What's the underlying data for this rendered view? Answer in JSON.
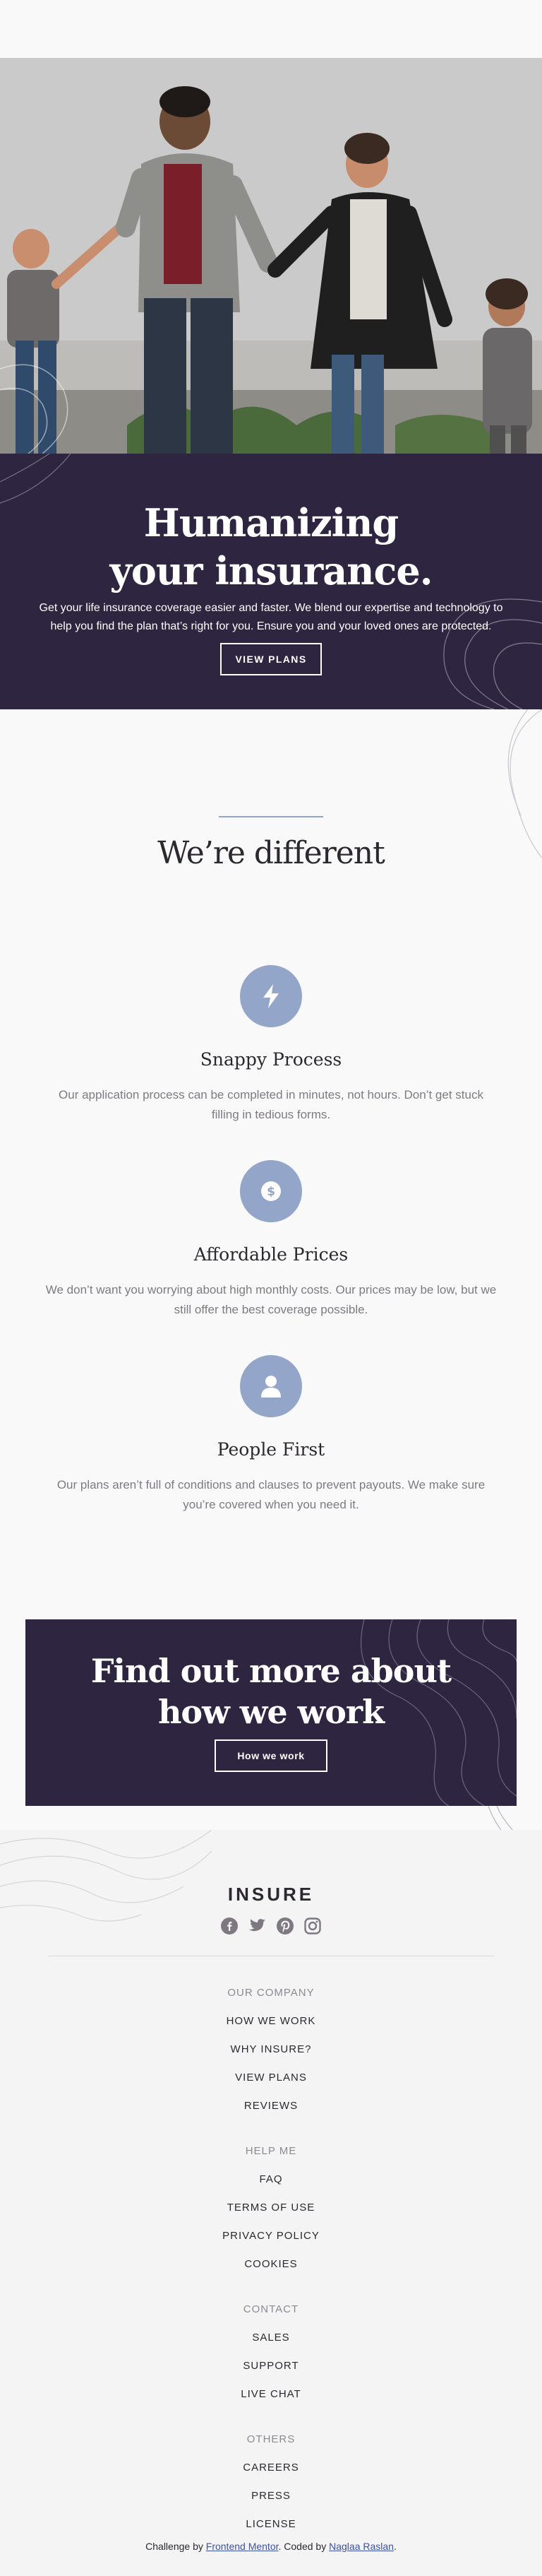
{
  "hero": {
    "title_line1": "Humanizing",
    "title_line2": "your insurance.",
    "text": "Get your life insurance coverage easier and faster. We blend our expertise and technology to help you find the plan that’s right for you. Ensure you and your loved ones are protected.",
    "button_label": "VIEW PLANS"
  },
  "different": {
    "title": "We’re different"
  },
  "features": [
    {
      "icon": "lightning-bolt-icon",
      "title": "Snappy Process",
      "text": "Our application process can be completed in minutes, not hours. Don’t get stuck filling in tedious forms."
    },
    {
      "icon": "dollar-coin-icon",
      "title": "Affordable Prices",
      "text": "We don’t want you worrying about high monthly costs. Our prices may be low, but we still offer the best coverage possible."
    },
    {
      "icon": "person-icon",
      "title": "People First",
      "text": "Our plans aren’t full of conditions and clauses to prevent payouts. We make sure you’re covered when you need it."
    }
  ],
  "cta": {
    "title_line1": "Find out more about",
    "title_line2": "how we work",
    "button_label": "How we work"
  },
  "footer": {
    "logo": "INSURE",
    "socials": [
      "facebook-icon",
      "twitter-icon",
      "pinterest-icon",
      "instagram-icon"
    ],
    "sections": [
      {
        "heading": "OUR COMPANY",
        "links": [
          "HOW WE WORK",
          "WHY INSURE?",
          "VIEW PLANS",
          "REVIEWS"
        ]
      },
      {
        "heading": "HELP ME",
        "links": [
          "FAQ",
          "TERMS OF USE",
          "PRIVACY POLICY",
          "COOKIES"
        ]
      },
      {
        "heading": "CONTACT",
        "links": [
          "SALES",
          "SUPPORT",
          "LIVE CHAT"
        ]
      },
      {
        "heading": "OTHERS",
        "links": [
          "CAREERS",
          "PRESS",
          "LICENSE"
        ]
      }
    ],
    "attribution": {
      "prefix": "Challenge by ",
      "challenge_link": "Frontend Mentor",
      "middle": ". Coded by ",
      "author_link": "Naglaa Raslan",
      "suffix": "."
    }
  },
  "colors": {
    "dark_violet": "#2e2541",
    "icon_blue": "#93a5c8",
    "background": "#f9f9f9"
  }
}
